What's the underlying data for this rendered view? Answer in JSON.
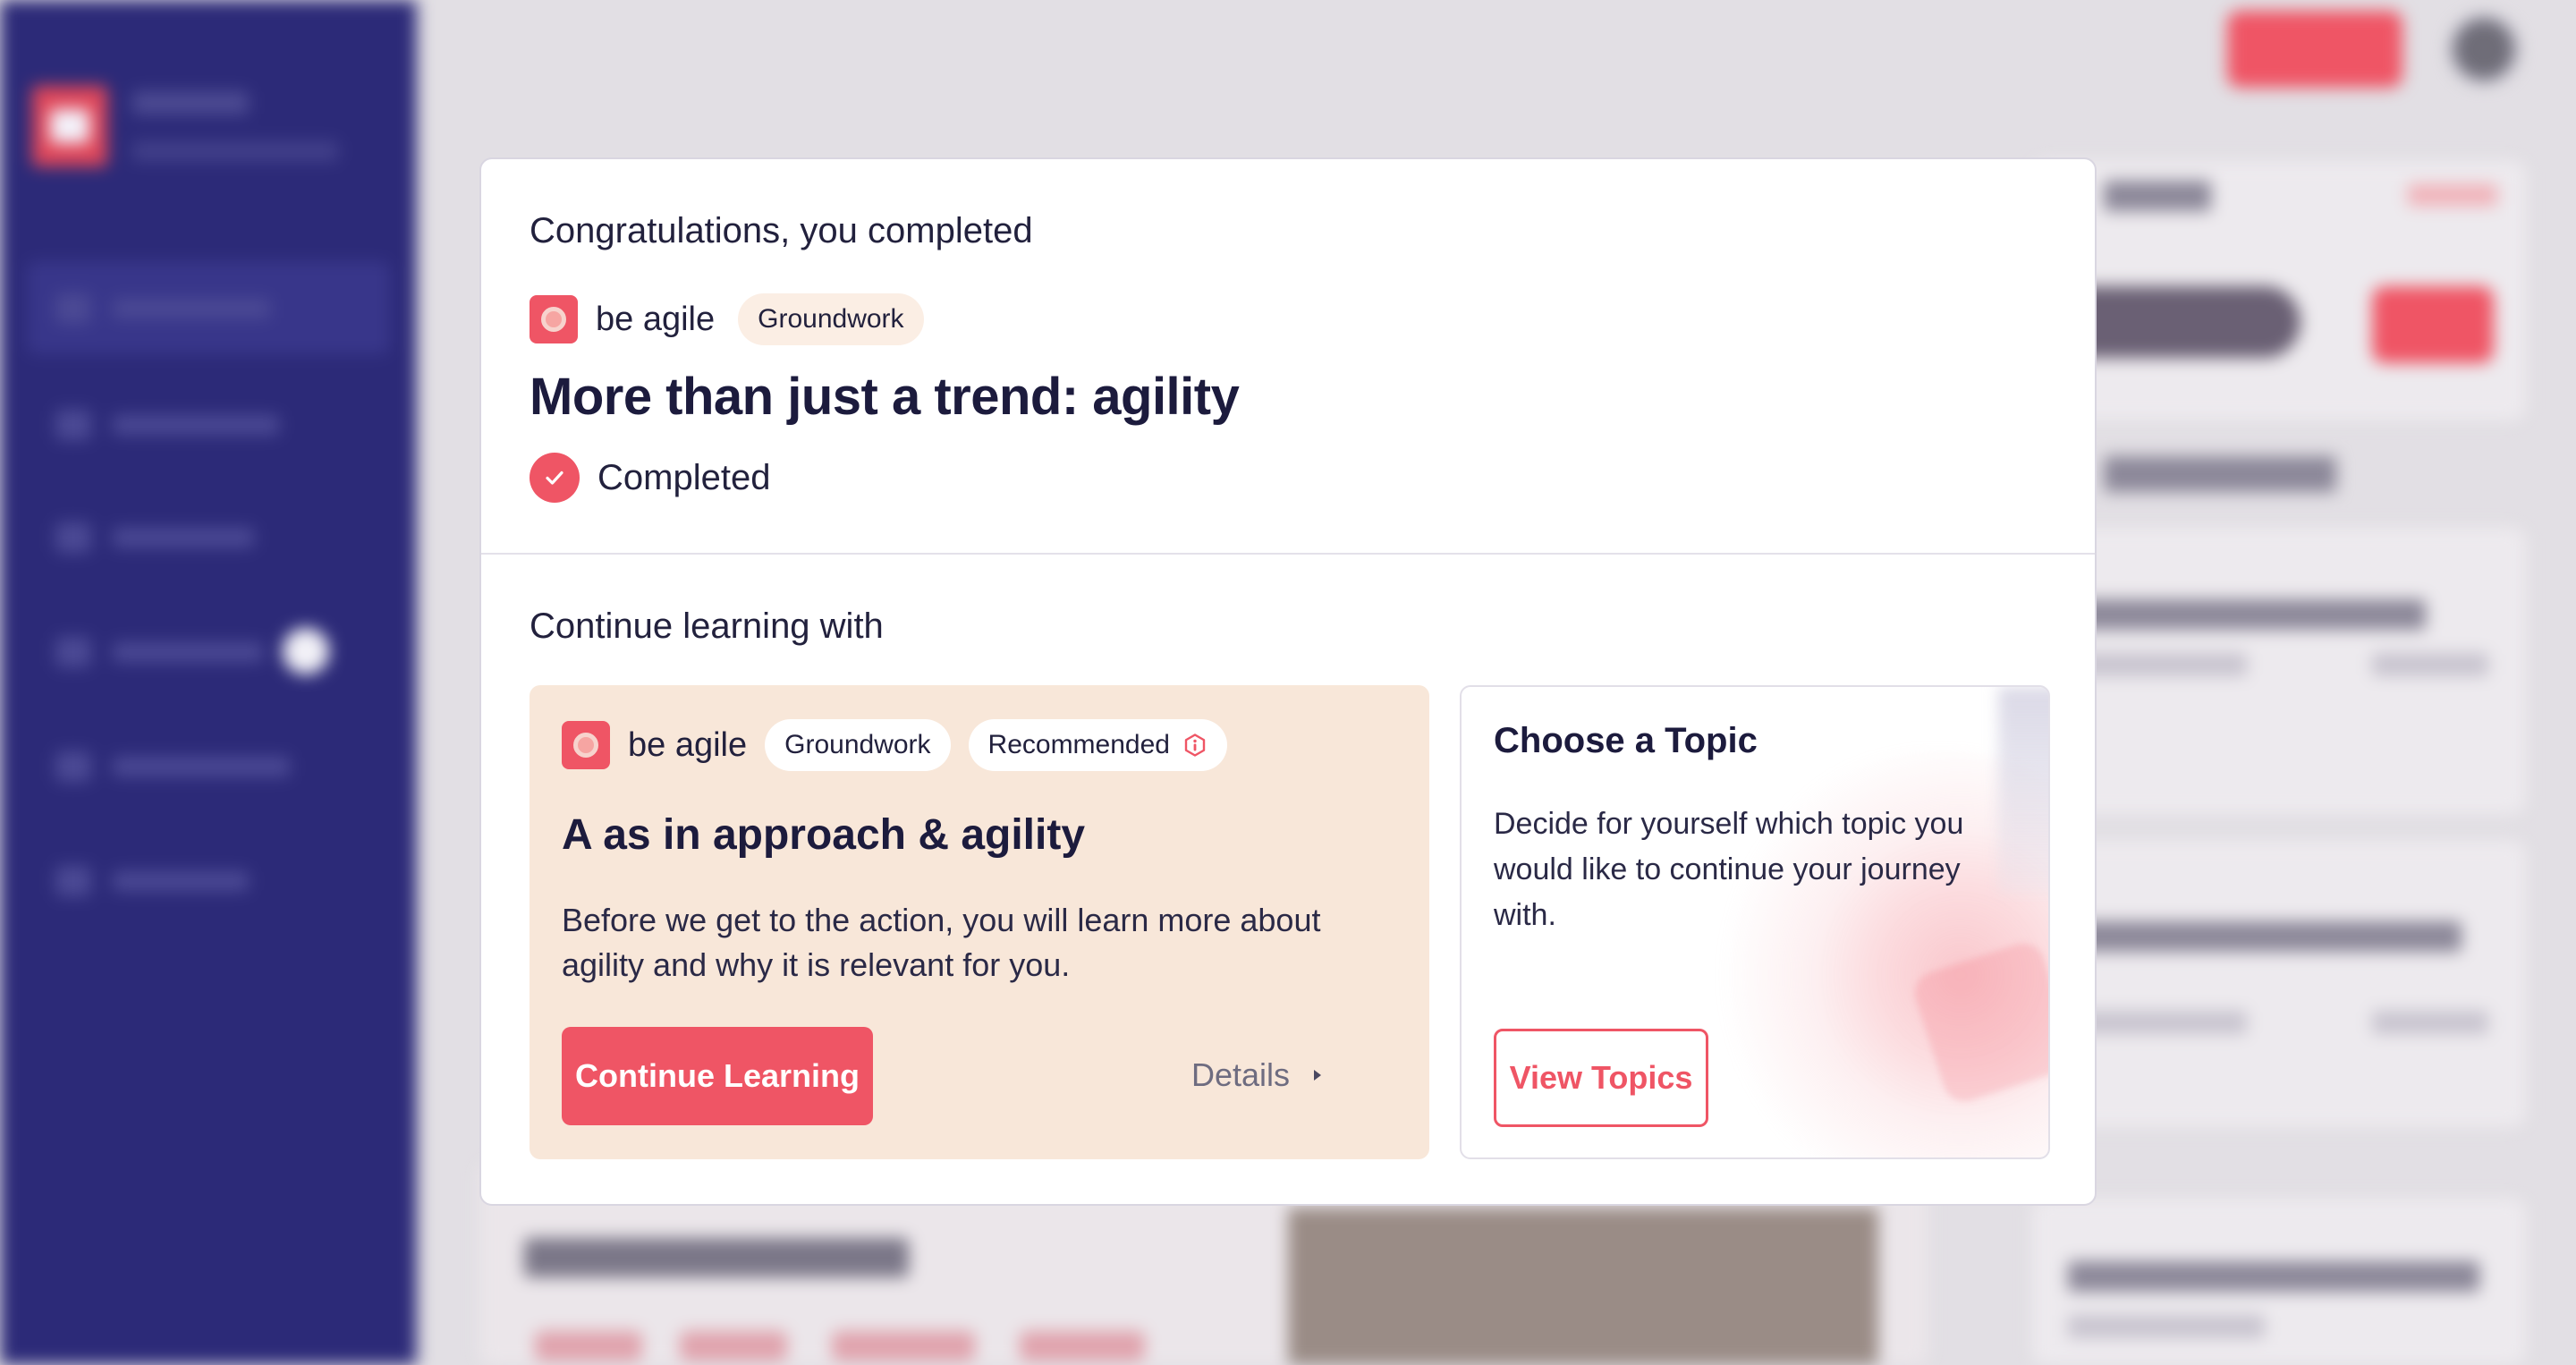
{
  "modal": {
    "heading": "Congratulations, you completed",
    "brand_icon": "be-agile-logo-icon",
    "brand": "be agile",
    "level": "Groundwork",
    "title": "More than just a trend: agility",
    "status_icon": "check-circle-icon",
    "status": "Completed",
    "continue_heading": "Continue learning with",
    "recommended_card": {
      "brand": "be agile",
      "level": "Groundwork",
      "badge": "Recommended",
      "badge_icon": "info-hexagon-icon",
      "title": "A as in approach & agility",
      "description": "Before we get to the action, you will learn more about agility and why it is relevant for you.",
      "primary_button": "Continue Learning",
      "details_link": "Details",
      "details_icon": "caret-right-icon"
    },
    "topic_card": {
      "title": "Choose a Topic",
      "description": "Decide for yourself which topic you would like to continue your journey with.",
      "button": "View Topics"
    }
  },
  "colors": {
    "accent": "#ef5565",
    "sidebar": "#2c2a78",
    "peach_card": "#f8e7d9",
    "chip_peach": "#fbeee4",
    "title_text": "#1c1b3d"
  }
}
